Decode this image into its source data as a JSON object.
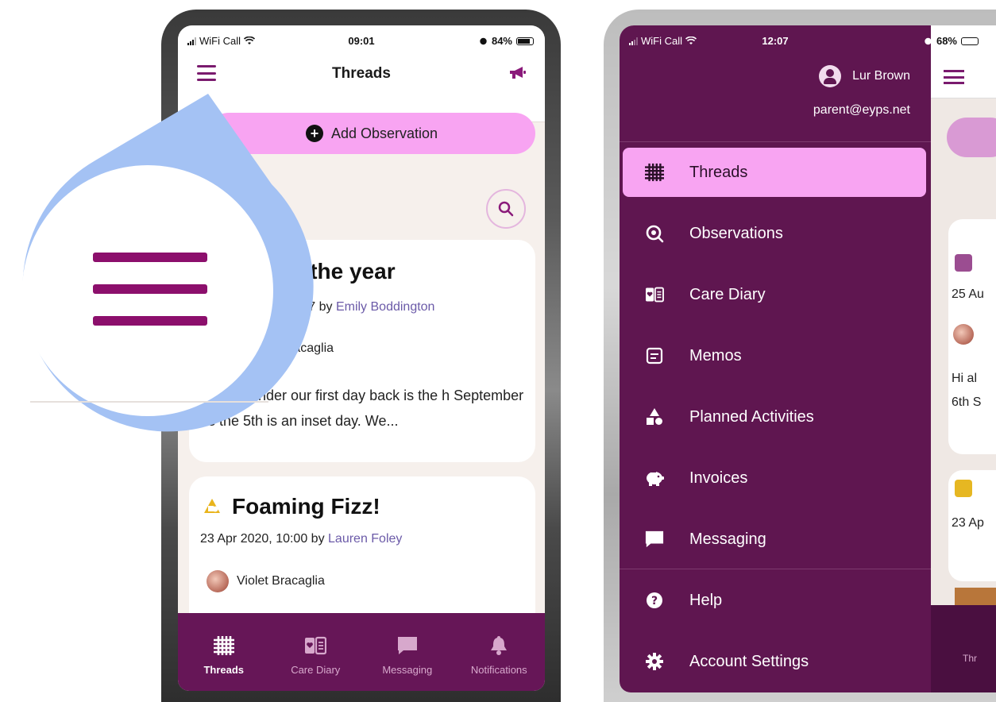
{
  "left_phone": {
    "status": {
      "carrier": "WiFi Call",
      "time": "09:01",
      "battery": "84%"
    },
    "nav": {
      "title": "Threads",
      "menu_icon": "hamburger-icon",
      "announce_icon": "megaphone-icon"
    },
    "add_observation_label": "Add Observation",
    "cards": [
      {
        "title": "of the year",
        "meta_time": "5:07 by ",
        "author": "Emily Boddington",
        "child": "racaglia",
        "body": "ist a reminder our first day back is the h September as the 5th is an inset day. We..."
      },
      {
        "title": "Foaming Fizz!",
        "meta_time": "23 Apr 2020, 10:00 by ",
        "author": "Lauren Foley",
        "child": "Violet Bracaglia"
      }
    ],
    "tabs": [
      {
        "label": "Threads",
        "icon": "threads-icon",
        "active": true
      },
      {
        "label": "Care Diary",
        "icon": "care-diary-icon",
        "active": false
      },
      {
        "label": "Messaging",
        "icon": "message-icon",
        "active": false
      },
      {
        "label": "Notifications",
        "icon": "bell-icon",
        "active": false
      }
    ]
  },
  "right_phone": {
    "status": {
      "carrier": "WiFi Call",
      "time": "12:07",
      "battery": "68%"
    },
    "user": {
      "name": "Lur Brown",
      "email": "parent@eyps.net"
    },
    "menu": [
      {
        "label": "Threads",
        "icon": "threads-icon",
        "active": true
      },
      {
        "label": "Observations",
        "icon": "observations-icon",
        "active": false
      },
      {
        "label": "Care Diary",
        "icon": "care-diary-icon",
        "active": false
      },
      {
        "label": "Memos",
        "icon": "memo-icon",
        "active": false
      },
      {
        "label": "Planned Activities",
        "icon": "shapes-icon",
        "active": false
      },
      {
        "label": "Invoices",
        "icon": "piggy-bank-icon",
        "active": false
      },
      {
        "label": "Messaging",
        "icon": "message-icon",
        "active": false
      },
      {
        "label": "Help",
        "icon": "help-icon",
        "active": false
      },
      {
        "label": "Account Settings",
        "icon": "gear-icon",
        "active": false
      }
    ],
    "behind": {
      "date1": "25 Au",
      "text1": "Hi al",
      "text2": "6th S",
      "date2": "23 Ap",
      "tab": "Thr"
    }
  },
  "colors": {
    "brand_purple": "#661657",
    "drawer_purple": "#5f1650",
    "pink_accent": "#f8a4f2",
    "author_link": "#6b5aa8",
    "bubble_blue": "#a4c2f4"
  }
}
